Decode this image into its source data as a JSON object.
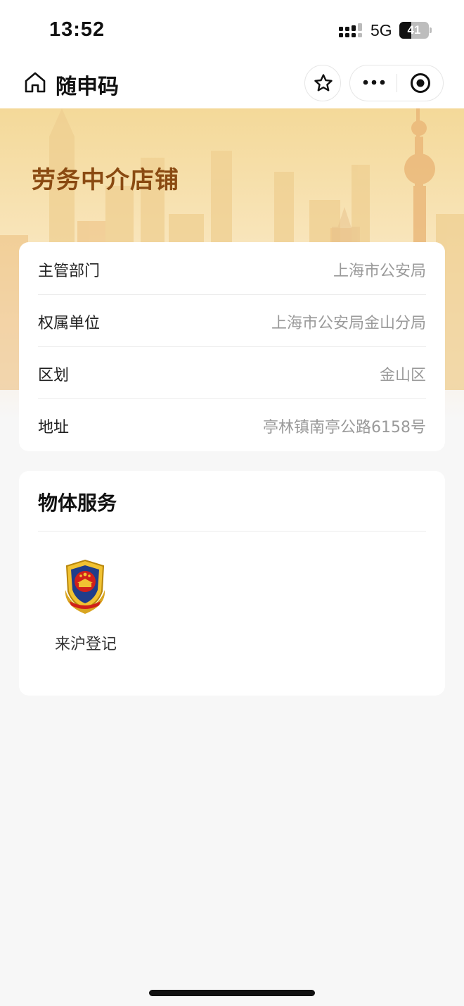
{
  "status_bar": {
    "time": "13:52",
    "network": "5G",
    "battery_level": "41",
    "battery_fraction": 0.41
  },
  "nav": {
    "title": "随申码",
    "icons": [
      "home-icon",
      "star-icon",
      "more-icon",
      "close-circle-icon"
    ]
  },
  "banner": {
    "title": "劳务中介店铺"
  },
  "info": {
    "rows": [
      {
        "label": "主管部门",
        "value": "上海市公安局"
      },
      {
        "label": "权属单位",
        "value": "上海市公安局金山分局"
      },
      {
        "label": "区划",
        "value": "金山区"
      },
      {
        "label": "地址",
        "value": "亭林镇南亭公路6158号"
      }
    ]
  },
  "services": {
    "title": "物体服务",
    "items": [
      {
        "label": "来沪登记",
        "icon": "police-emblem-icon"
      }
    ]
  },
  "colors": {
    "banner_title": "#8a4a12",
    "value_text": "#9a9a9a",
    "page_bg": "#f7f7f7"
  }
}
